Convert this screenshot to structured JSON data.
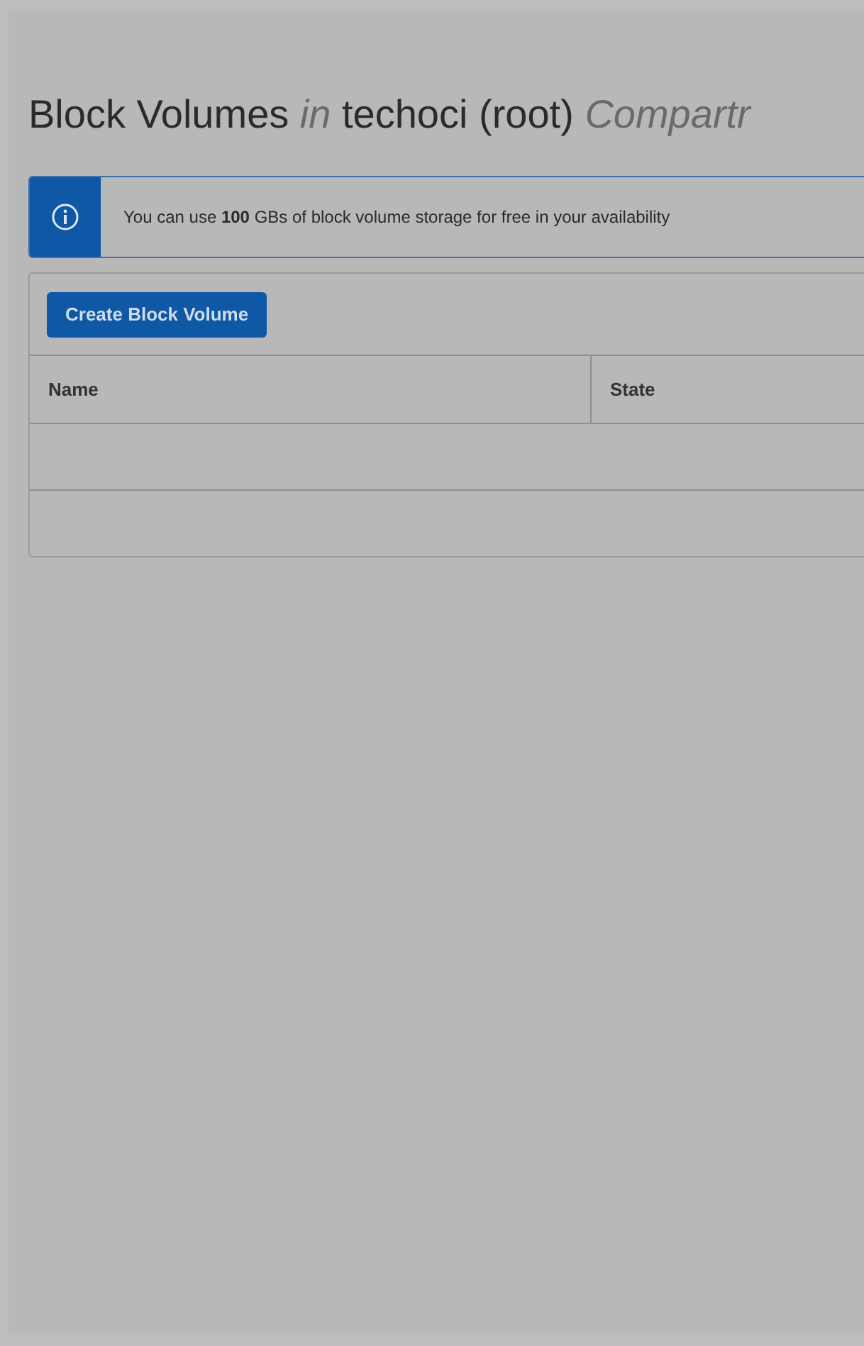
{
  "title": [
    {
      "kind": "plain",
      "text": "Block Volumes"
    },
    {
      "kind": "muted",
      "text": "in"
    },
    {
      "kind": "plain",
      "text": "techoci (root)"
    },
    {
      "kind": "muted",
      "text": "Compartr"
    }
  ],
  "notice": {
    "text": "You can use **100** GBs of block volume storage for free in your availability"
  },
  "create_button": "Create Block Volume",
  "table": {
    "columns": [
      "Name",
      "State"
    ],
    "rows": [
      {},
      {}
    ]
  }
}
